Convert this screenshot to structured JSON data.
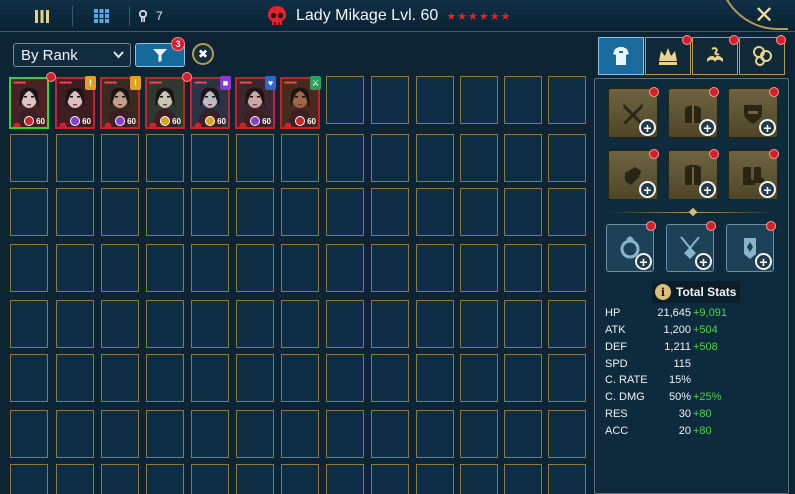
{
  "header": {
    "menu_icon": "bars-icon",
    "grid_icon": "grid-icon",
    "key_count": "7",
    "title": "Lady Mikage Lvl. 60",
    "stars": "★★★★★★",
    "close_icon": "close-icon"
  },
  "filters": {
    "sort_value": "By Rank",
    "filter_count": "3",
    "clear_icon": "✖"
  },
  "champions": [
    {
      "level": "60",
      "selected": true,
      "portrait_color": "#4a2226",
      "skin": "#d9c6c2",
      "affinity": "#c8282c",
      "badge": "",
      "badge_color": ""
    },
    {
      "level": "60",
      "selected": false,
      "portrait_color": "#3e1c22",
      "skin": "#d6c4c0",
      "affinity": "#8a3cd0",
      "badge": "!",
      "badge_color": "#e0a020"
    },
    {
      "level": "60",
      "selected": false,
      "portrait_color": "#3a2a22",
      "skin": "#bfa088",
      "affinity": "#8a3cd0",
      "badge": "!",
      "badge_color": "#e0a020"
    },
    {
      "level": "60",
      "selected": false,
      "portrait_color": "#2e3a30",
      "skin": "#c2c8b8",
      "affinity": "#e0a020",
      "badge": "",
      "badge_color": ""
    },
    {
      "level": "60",
      "selected": false,
      "portrait_color": "#2a3448",
      "skin": "#b6bcc8",
      "affinity": "#e0a020",
      "badge": "■",
      "badge_color": "#8a3cd0"
    },
    {
      "level": "60",
      "selected": false,
      "portrait_color": "#3c2630",
      "skin": "#c8a8a8",
      "affinity": "#8a3cd0",
      "badge": "♥",
      "badge_color": "#2a6ad0"
    },
    {
      "level": "60",
      "selected": false,
      "portrait_color": "#4a2a1c",
      "skin": "#9a6a4a",
      "affinity": "#c8282c",
      "badge": "⚔",
      "badge_color": "#28a060"
    }
  ],
  "tabs": [
    {
      "name": "tab-armor",
      "icon": "armor-icon",
      "active": true
    },
    {
      "name": "tab-masteries",
      "icon": "crown-icon",
      "active": false
    },
    {
      "name": "tab-skills",
      "icon": "tome-icon",
      "active": false
    },
    {
      "name": "tab-currency",
      "icon": "coins-icon",
      "active": false
    }
  ],
  "gear_slots": [
    {
      "name": "weapon-slot",
      "icon": "sword-icon"
    },
    {
      "name": "helmet-slot",
      "icon": "helmet-icon"
    },
    {
      "name": "shield-slot",
      "icon": "shield-icon"
    },
    {
      "name": "gloves-slot",
      "icon": "gloves-icon"
    },
    {
      "name": "chest-slot",
      "icon": "chestplate-icon"
    },
    {
      "name": "boots-slot",
      "icon": "boots-icon"
    }
  ],
  "accessory_slots": [
    {
      "name": "ring-slot",
      "icon": "ring-icon"
    },
    {
      "name": "amulet-slot",
      "icon": "amulet-icon"
    },
    {
      "name": "banner-slot",
      "icon": "banner-icon"
    }
  ],
  "total_stats_label": "Total Stats",
  "stats": [
    {
      "name": "HP",
      "value": "21,645",
      "bonus": "+9,091"
    },
    {
      "name": "ATK",
      "value": "1,200",
      "bonus": "+504"
    },
    {
      "name": "DEF",
      "value": "1,211",
      "bonus": "+508"
    },
    {
      "name": "SPD",
      "value": "115",
      "bonus": ""
    },
    {
      "name": "C. RATE",
      "value": "15%",
      "bonus": ""
    },
    {
      "name": "C. DMG",
      "value": "50%",
      "bonus": "+25%"
    },
    {
      "name": "RES",
      "value": "30",
      "bonus": "+80"
    },
    {
      "name": "ACC",
      "value": "20",
      "bonus": "+80"
    }
  ],
  "colors": {
    "accent_gold": "#b59a54",
    "active_blue": "#1b6a9e",
    "bonus_green": "#4ed24e",
    "alert_red": "#d4202a"
  }
}
